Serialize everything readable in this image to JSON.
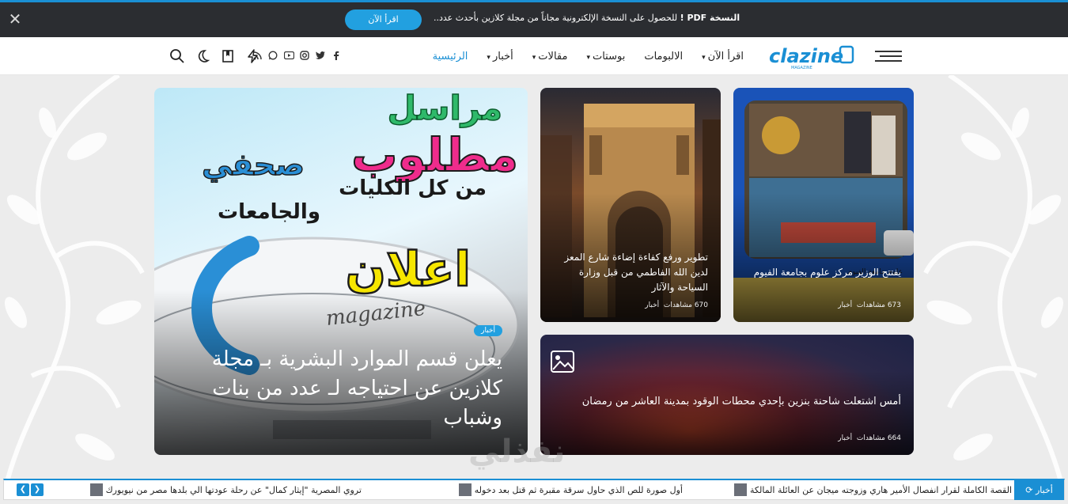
{
  "promo": {
    "text_bold": "النسخة PDF !",
    "text": " للحصول على النسخة الإلكترونية مجاناً من مجلة كلازين بأحدث عدد..",
    "button": "اقرأ الآن",
    "close_icon": "close-icon"
  },
  "header": {
    "logo_text": "clazine",
    "nav": [
      {
        "label": "الرئيسية",
        "dropdown": false
      },
      {
        "label": "أخبار",
        "dropdown": true
      },
      {
        "label": "مقالات",
        "dropdown": true
      },
      {
        "label": "بوستات",
        "dropdown": true
      },
      {
        "label": "الالبومات",
        "dropdown": false
      },
      {
        "label": "اقرأ الآن",
        "dropdown": true
      }
    ],
    "accent": "#1a8fd4"
  },
  "cards": {
    "big": {
      "category": "أخبار",
      "title": "يعلن قسم الموارد البشرية بـ مجلة كلازين عن احتياجه لـ عدد من بنات وشباب",
      "poster": {
        "line1": "مراسل",
        "line2": "مطلوب",
        "line3": "صحفي",
        "line4": "من كل الكليات",
        "line5": "والجامعات",
        "line6": "اعلان",
        "brand": "magazine"
      }
    },
    "mosque": {
      "title": "تطوير ورفع كفاءة إضاءة شارع المعز لدين الله الفاطمي من قبل وزارة السياحة والآثار",
      "views": "670 مشاهدات",
      "category": "أخبار"
    },
    "minister": {
      "title": "يفتتح الوزير مركز علوم بجامعة الفيوم",
      "views": "673 مشاهدات",
      "category": "أخبار"
    },
    "fire": {
      "title": "أمس اشتعلت شاحنة بنزين بإحدي محطات الوقود بمدينة العاشر من رمضان",
      "views": "664 مشاهدات",
      "category": "أخبار"
    }
  },
  "ticker": {
    "label": "أخبار",
    "items": [
      "القصة الكاملة لقرار انفصال الأمير هاري وزوجته ميجان عن العائلة المالكة",
      "أول صورة للص الذي حاول سرقة مقبرة ثم قتل بعد دخوله",
      "تروي المصرية \"إيثار كمال\" عن رحلة عودتها الي بلدها مصر من نيويورك"
    ]
  },
  "watermark": "نفذلي"
}
